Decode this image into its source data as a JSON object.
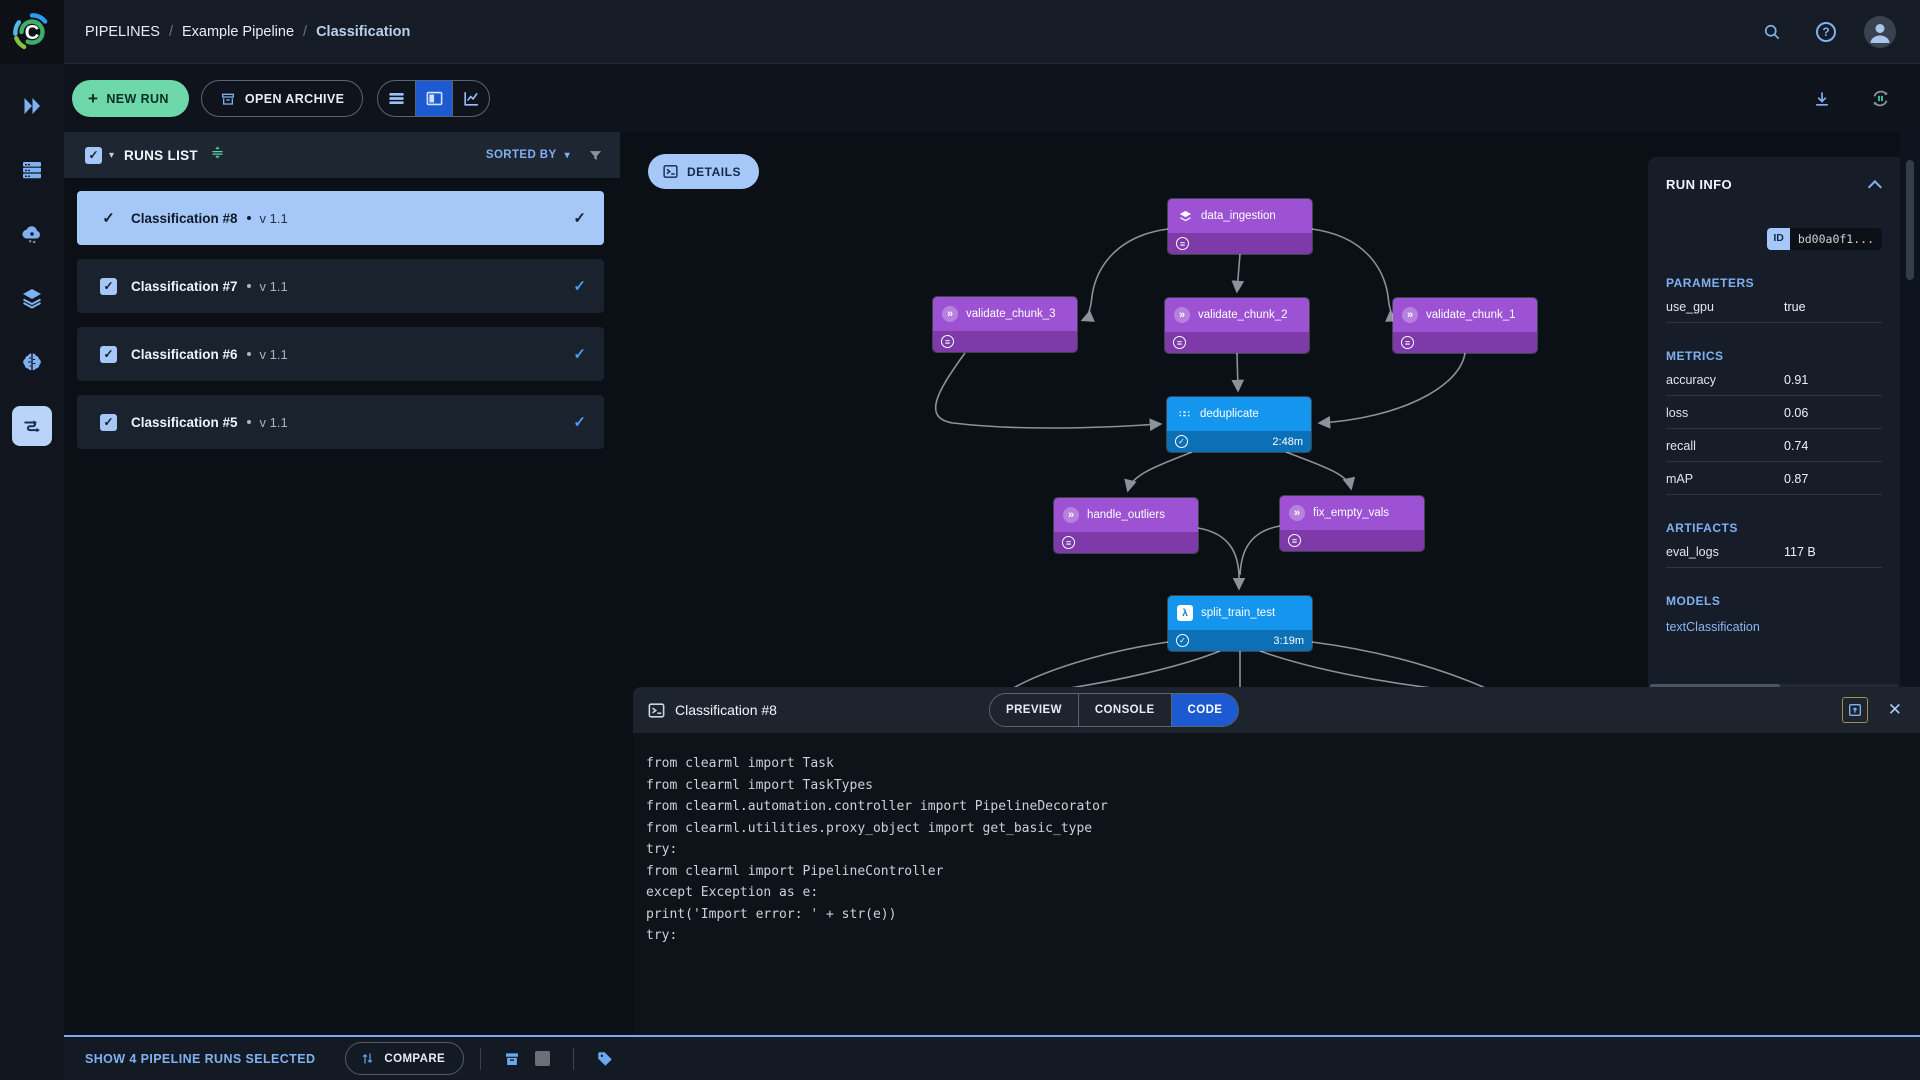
{
  "colors": {
    "accent_blue": "#1d5ad1",
    "accent_mint": "#6fd8ab",
    "selection_blue": "#a6c8f8",
    "node_purple": "#9c52d3",
    "node_purple_dark": "#7d3aa8",
    "node_blue": "#1596ee",
    "node_blue_dark": "#0b70b6",
    "link_blue": "#7fb1f2"
  },
  "sidebar": {
    "icons": [
      "projects-icon",
      "workers-queues-icon",
      "autoscalers-icon",
      "datasets-icon",
      "models-icon",
      "pipelines-icon"
    ],
    "active": "pipelines-icon"
  },
  "topbar": {
    "breadcrumb": [
      "PIPELINES",
      "Example Pipeline",
      "Classification"
    ],
    "separator": "/"
  },
  "toolbar": {
    "new_run_label": "NEW RUN",
    "open_archive_label": "OPEN ARCHIVE",
    "view_modes": [
      "table-view-icon",
      "split-view-icon",
      "plots-view-icon"
    ],
    "active_view_index": 1
  },
  "runs": {
    "title": "RUNS LIST",
    "sorted_by_label": "SORTED BY",
    "items": [
      {
        "name": "Classification #8",
        "version": "v 1.1",
        "selected": true
      },
      {
        "name": "Classification #7",
        "version": "v 1.1",
        "selected": false
      },
      {
        "name": "Classification #6",
        "version": "v 1.1",
        "selected": false
      },
      {
        "name": "Classification #5",
        "version": "v 1.1",
        "selected": false
      }
    ]
  },
  "graph": {
    "details_label": "DETAILS",
    "nodes": [
      {
        "label": "data_ingestion",
        "kind": "dataset",
        "status": "pending"
      },
      {
        "label": "validate_chunk_3",
        "kind": "task",
        "status": "pending"
      },
      {
        "label": "validate_chunk_2",
        "kind": "task",
        "status": "pending"
      },
      {
        "label": "validate_chunk_1",
        "kind": "task",
        "status": "pending"
      },
      {
        "label": "deduplicate",
        "kind": "task",
        "status": "completed",
        "duration": "2:48m"
      },
      {
        "label": "handle_outliers",
        "kind": "task",
        "status": "pending"
      },
      {
        "label": "fix_empty_vals",
        "kind": "task",
        "status": "pending"
      },
      {
        "label": "split_train_test",
        "kind": "function",
        "status": "completed",
        "duration": "3:19m"
      }
    ]
  },
  "run_info": {
    "title": "RUN INFO",
    "id_label": "ID",
    "id_value": "bd00a0f1...",
    "sections": [
      {
        "title": "PARAMETERS",
        "rows": [
          {
            "label": "use_gpu",
            "value": "true"
          }
        ]
      },
      {
        "title": "METRICS",
        "rows": [
          {
            "label": "accuracy",
            "value": "0.91"
          },
          {
            "label": "loss",
            "value": "0.06"
          },
          {
            "label": "recall",
            "value": "0.74"
          },
          {
            "label": "mAP",
            "value": "0.87"
          }
        ]
      },
      {
        "title": "ARTIFACTS",
        "rows": [
          {
            "label": "eval_logs",
            "value": "117 B"
          }
        ]
      },
      {
        "title": "MODELS",
        "rows": [
          {
            "label": "textClassification",
            "value": ""
          }
        ]
      }
    ]
  },
  "bottom_panel": {
    "title": "Classification #8",
    "tabs": [
      "PREVIEW",
      "CONSOLE",
      "CODE"
    ],
    "active_tab": "CODE",
    "code_lines": [
      "from clearml import Task",
      "from clearml import TaskTypes",
      "from clearml.automation.controller import PipelineDecorator",
      "",
      "from clearml.utilities.proxy_object import get_basic_type",
      "",
      "try:",
      "from clearml import PipelineController",
      "except Exception as e:",
      "print('Import error: ' + str(e))",
      "",
      "try:"
    ]
  },
  "footer": {
    "selection_text": "SHOW 4 PIPELINE RUNS SELECTED",
    "compare_label": "COMPARE"
  }
}
